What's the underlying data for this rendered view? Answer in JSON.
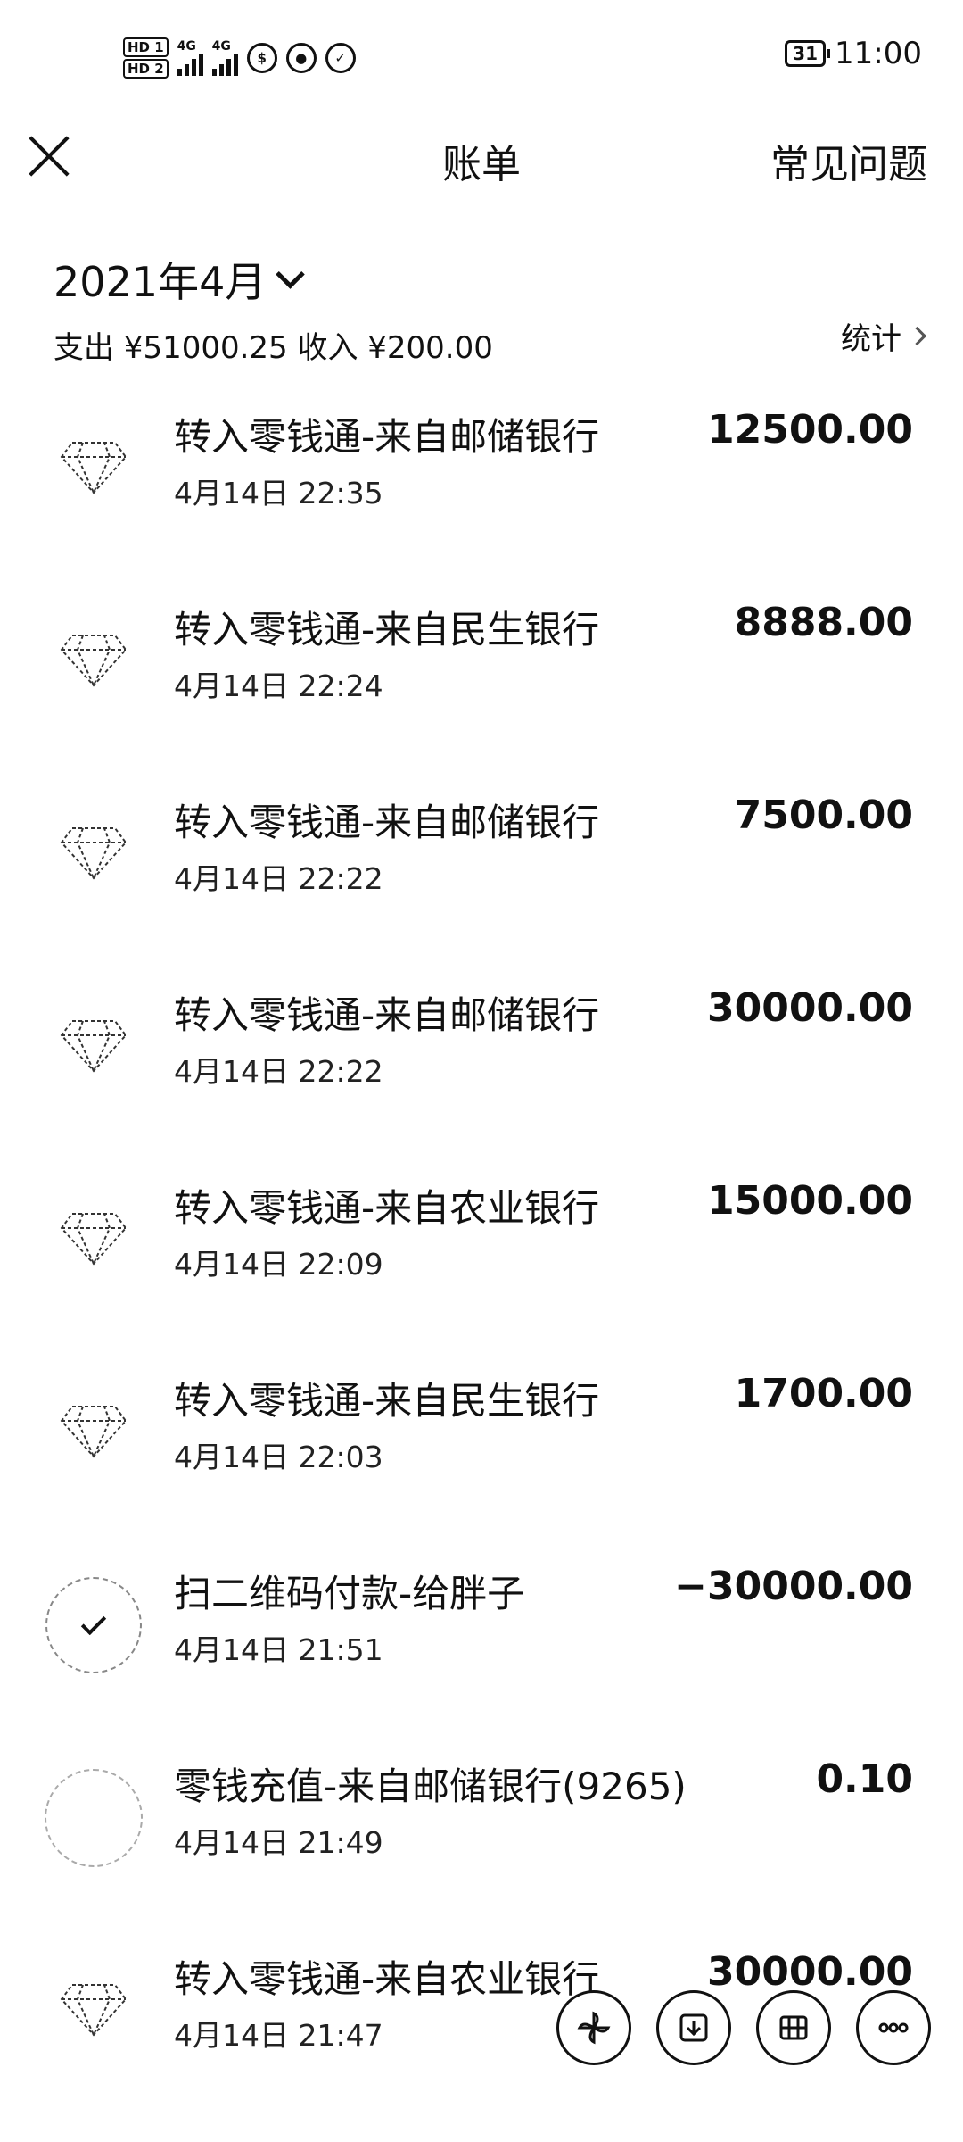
{
  "status_bar": {
    "sim1": "HD 1",
    "sim2": "HD 2",
    "network1": "4G",
    "network2": "4G",
    "battery": "31",
    "time": "11:00"
  },
  "nav": {
    "title": "账单",
    "faq": "常见问题",
    "close_icon": "close-icon"
  },
  "filter": {
    "month": "2021年4月",
    "summary": "支出 ¥51000.25 收入 ¥200.00",
    "stats": "统计"
  },
  "transactions": [
    {
      "title": "转入零钱通-来自邮储银行",
      "time": "4月14日 22:35",
      "amount": "12500.00",
      "icon": "diamond-icon"
    },
    {
      "title": "转入零钱通-来自民生银行",
      "time": "4月14日 22:24",
      "amount": "8888.00",
      "icon": "diamond-icon"
    },
    {
      "title": "转入零钱通-来自邮储银行",
      "time": "4月14日 22:22",
      "amount": "7500.00",
      "icon": "diamond-icon"
    },
    {
      "title": "转入零钱通-来自邮储银行",
      "time": "4月14日 22:22",
      "amount": "30000.00",
      "icon": "diamond-icon"
    },
    {
      "title": "转入零钱通-来自农业银行",
      "time": "4月14日 22:09",
      "amount": "15000.00",
      "icon": "diamond-icon"
    },
    {
      "title": "转入零钱通-来自民生银行",
      "time": "4月14日 22:03",
      "amount": "1700.00",
      "icon": "diamond-icon"
    },
    {
      "title": "扫二维码付款-给胖子",
      "time": "4月14日 21:51",
      "amount": "−30000.00",
      "icon": "qr-pay-icon"
    },
    {
      "title": "零钱充值-来自邮储银行(9265)",
      "time": "4月14日 21:49",
      "amount": "0.10",
      "icon": "wallet-icon"
    },
    {
      "title": "转入零钱通-来自农业银行",
      "time": "4月14日 21:47",
      "amount": "30000.00",
      "icon": "diamond-icon"
    }
  ],
  "floating_actions": [
    "pinwheel-icon",
    "download-icon",
    "grid-icon",
    "more-icon"
  ]
}
